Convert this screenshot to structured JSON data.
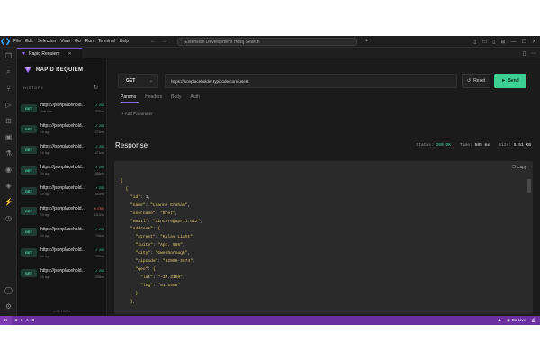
{
  "titlebar": {
    "menu": [
      "File",
      "Edit",
      "Selection",
      "View",
      "Go",
      "Run",
      "Terminal",
      "Help"
    ],
    "search_text": "[Extension Development Host] Search"
  },
  "tab": {
    "label": "Rapid Requiem"
  },
  "sidebar": {
    "brand": "RAPID REQUIEM",
    "history_title": "HISTORY",
    "footer": "v 0.0.1 BETA",
    "items": [
      {
        "method": "GET",
        "url": "https://jsonplaceholder.typicode.com/users",
        "status": "✓ 200",
        "ago": "Just now",
        "ms": "505ms",
        "error": false
      },
      {
        "method": "GET",
        "url": "https://jsonplaceholder.typicode.com/users",
        "status": "✓ 200",
        "ago": "1h ago",
        "ms": "1074ms",
        "error": false
      },
      {
        "method": "GET",
        "url": "https://jsonplaceholder.typicode.com/users",
        "status": "✓ 200",
        "ago": "1h ago",
        "ms": "1471ms",
        "error": false
      },
      {
        "method": "GET",
        "url": "https://jsonplaceholder.typicode.com/users",
        "status": "✓ 200",
        "ago": "1h ago",
        "ms": "586ms",
        "error": false
      },
      {
        "method": "GET",
        "url": "https://jsonplaceholder.typicode.com/users",
        "status": "✓ 200",
        "ago": "1h ago",
        "ms": "642ms",
        "error": false
      },
      {
        "method": "GET",
        "url": "https://jsonplaceholder.typicode.com/users",
        "status": "✕ ERR",
        "ago": "1h ago",
        "ms": "1113ms",
        "error": true
      },
      {
        "method": "GET",
        "url": "https://jsonplaceholder.typicode.com/users",
        "status": "✓ 200",
        "ago": "1h ago",
        "ms": "746ms",
        "error": false
      },
      {
        "method": "GET",
        "url": "https://jsonplaceholder.typicode.com/users",
        "status": "✓ 200",
        "ago": "1h ago",
        "ms": "385ms",
        "error": false
      },
      {
        "method": "GET",
        "url": "https://jsonplaceholder.typicode.com/users",
        "status": "✓ 200",
        "ago": "1h ago",
        "ms": "298ms",
        "error": false
      }
    ]
  },
  "request": {
    "method": "GET",
    "url": "https://jsonplaceholder.typicode.com/users",
    "reset_label": "Reset",
    "send_label": "Send",
    "tabs": [
      "Params",
      "Headers",
      "Body",
      "Auth"
    ],
    "add_param_label": "+ Add Parameter"
  },
  "response": {
    "title": "Response",
    "status_label": "Status:",
    "status_value": "200 OK",
    "time_label": "Time:",
    "time_value": "505 ms",
    "size_label": "Size:",
    "size_value": "5.51 KB",
    "copy_label": "Copy"
  },
  "statusbar": {
    "errors": "0",
    "warnings": "0",
    "port": "Go Live"
  },
  "colors": {
    "accent_purple": "#6c2fa0",
    "send_green": "#3ccf91",
    "success": "#4ad39e",
    "error": "#e25c5c"
  }
}
